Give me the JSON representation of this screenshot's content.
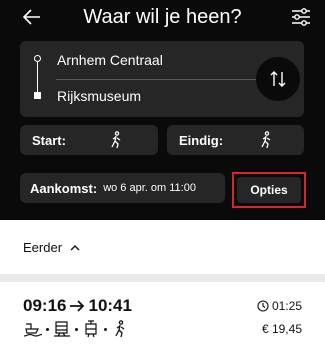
{
  "header": {
    "title": "Waar wil je heen?",
    "back_icon": "arrow-left-icon",
    "filter_icon": "sliders-icon"
  },
  "route": {
    "from": "Arnhem Centraal",
    "to": "Rijksmuseum",
    "swap_icon": "swap-vertical-icon"
  },
  "start": {
    "label": "Start:",
    "icon": "walking-icon"
  },
  "end": {
    "label": "Eindig:",
    "icon": "walking-icon"
  },
  "arrival": {
    "label": "Aankomst:",
    "value": "wo 6 apr. om 11:00"
  },
  "options": {
    "label": "Opties"
  },
  "earlier": {
    "label": "Eerder"
  },
  "result": {
    "departure": "09:16",
    "arrival": "10:41",
    "duration": "01:25",
    "price": "€ 19,45",
    "legs": [
      "ferry-icon",
      "train-icon",
      "tram-icon",
      "walking-icon"
    ]
  },
  "colors": {
    "header_bg": "#0a0a0a",
    "panel_bg": "#262626",
    "highlight": "#d9262c"
  }
}
